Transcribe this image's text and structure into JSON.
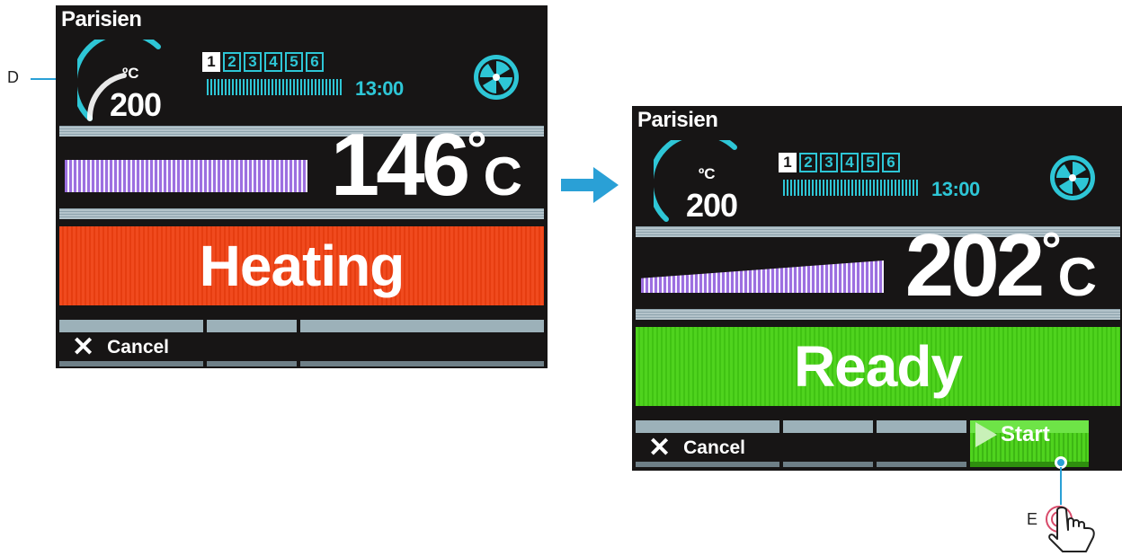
{
  "screen_heating": {
    "program_name": "Parisien",
    "setpoint_unit": "ºC",
    "setpoint_value": "200",
    "steps": [
      "1",
      "2",
      "3",
      "4",
      "5",
      "6"
    ],
    "time": "13:00",
    "current_temp": "146",
    "temp_unit": "C",
    "status": "Heating",
    "status_color": "#f04a1e",
    "cancel_label": "Cancel"
  },
  "screen_ready": {
    "program_name": "Parisien",
    "setpoint_unit": "ºC",
    "setpoint_value": "200",
    "steps": [
      "1",
      "2",
      "3",
      "4",
      "5",
      "6"
    ],
    "time": "13:00",
    "current_temp": "202",
    "temp_unit": "C",
    "status": "Ready",
    "status_color": "#4fd31e",
    "cancel_label": "Cancel",
    "start_label": "Start"
  },
  "callouts": {
    "d_label": "D",
    "e_label": "E"
  },
  "colors": {
    "accent": "#2ec6d6",
    "callout": "#2aa0d6"
  },
  "icons": [
    "gauge-arc-icon",
    "fan-icon",
    "close-icon",
    "play-icon",
    "arrow-right-icon",
    "tap-hand-icon"
  ]
}
